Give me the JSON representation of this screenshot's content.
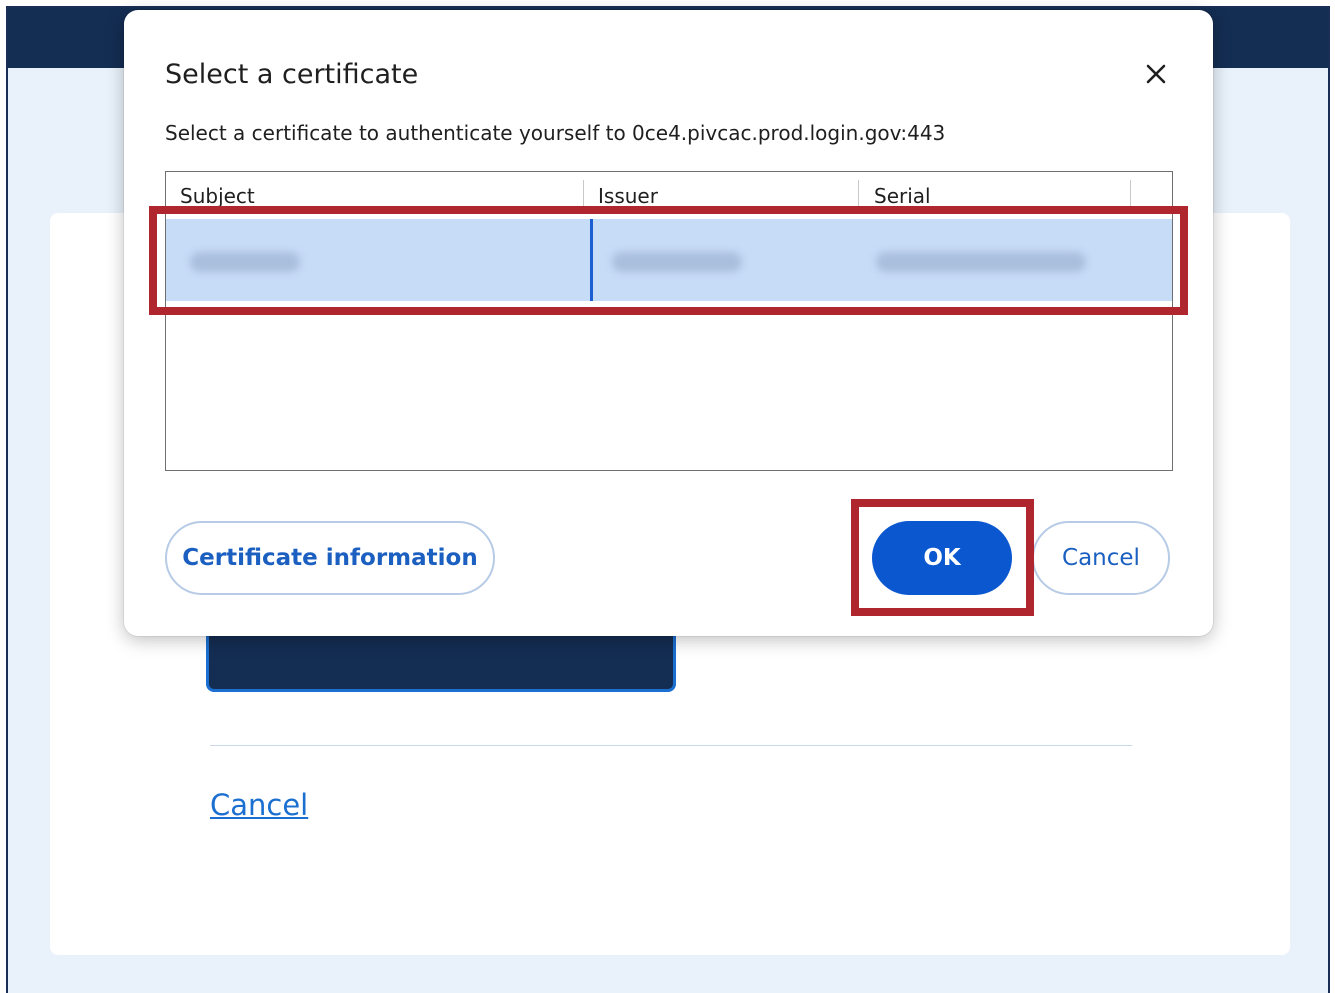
{
  "dialog": {
    "title": "Select a certificate",
    "subtitle": "Select a certificate to authenticate yourself to 0ce4.pivcac.prod.login.gov:443",
    "close_icon": "close-icon"
  },
  "table": {
    "columns": [
      "Subject",
      "Issuer",
      "Serial"
    ],
    "rows": [
      {
        "subject": "",
        "issuer": "",
        "serial": "",
        "selected": true,
        "redacted": true
      }
    ]
  },
  "buttons": {
    "certificate_info": "Certificate information",
    "ok": "OK",
    "cancel": "Cancel"
  },
  "page": {
    "cancel_link": "Cancel"
  },
  "colors": {
    "navy": "#142d52",
    "page_bg": "#e9f1fa",
    "primary": "#0b57d0",
    "selection": "#c7dcf7",
    "annotation_red": "#b0262e"
  }
}
